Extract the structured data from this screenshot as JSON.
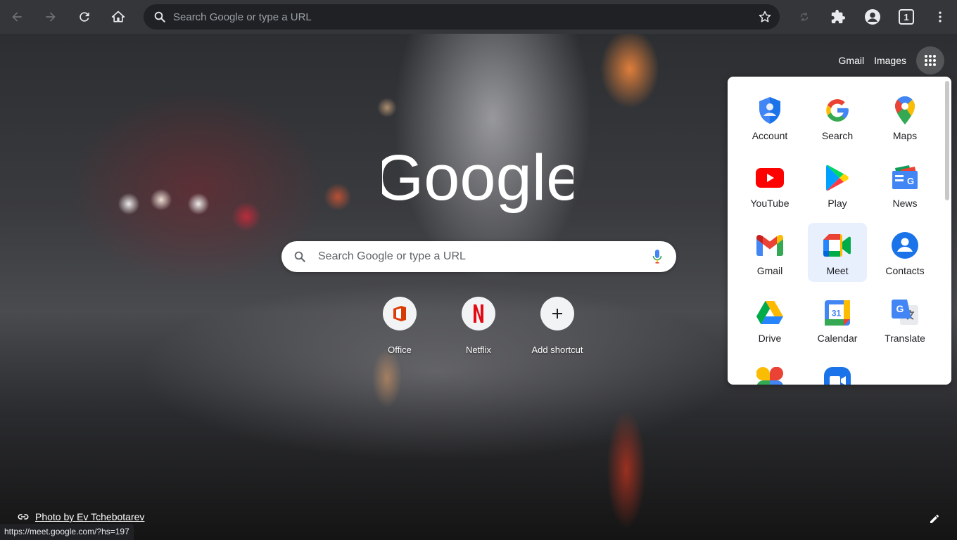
{
  "toolbar": {
    "omnibox_placeholder": "Search Google or type a URL",
    "tab_count": "1"
  },
  "ntp": {
    "top_links": {
      "gmail": "Gmail",
      "images": "Images"
    },
    "logo_text": "Google",
    "search_placeholder": "Search Google or type a URL",
    "shortcuts": [
      {
        "label": "Office",
        "icon": "office-icon"
      },
      {
        "label": "Netflix",
        "icon": "netflix-icon"
      },
      {
        "label": "Add shortcut",
        "icon": "plus-icon"
      }
    ],
    "attribution": "Photo by Ev Tchebotarev",
    "status_url": "https://meet.google.com/?hs=197"
  },
  "apps_panel": {
    "items": [
      {
        "label": "Account",
        "icon": "account-icon"
      },
      {
        "label": "Search",
        "icon": "google-g-icon"
      },
      {
        "label": "Maps",
        "icon": "maps-icon"
      },
      {
        "label": "YouTube",
        "icon": "youtube-icon"
      },
      {
        "label": "Play",
        "icon": "play-icon"
      },
      {
        "label": "News",
        "icon": "news-icon"
      },
      {
        "label": "Gmail",
        "icon": "gmail-icon"
      },
      {
        "label": "Meet",
        "icon": "meet-icon",
        "highlighted": true
      },
      {
        "label": "Contacts",
        "icon": "contacts-icon"
      },
      {
        "label": "Drive",
        "icon": "drive-icon"
      },
      {
        "label": "Calendar",
        "icon": "calendar-icon",
        "icon_text": "31"
      },
      {
        "label": "Translate",
        "icon": "translate-icon"
      }
    ]
  },
  "colors": {
    "toolbar_bg": "#35363a",
    "omnibox_bg": "#202124",
    "google_blue": "#4285f4",
    "google_red": "#ea4335",
    "google_yellow": "#fbbc04",
    "google_green": "#34a853",
    "meet_highlight": "#e8f0fe"
  }
}
